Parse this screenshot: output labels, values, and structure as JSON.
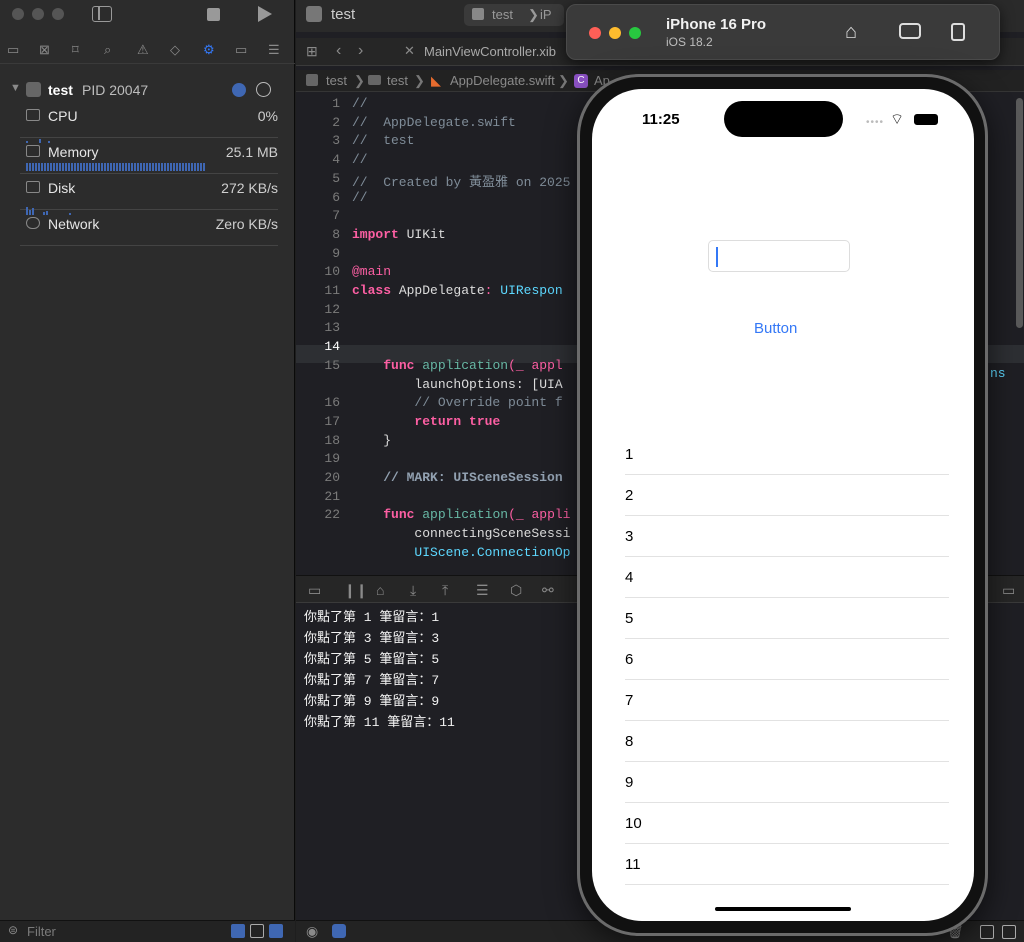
{
  "left_panel": {
    "process_name": "test",
    "process_pid": "PID 20047",
    "gauges": [
      {
        "label": "CPU",
        "value": "0%"
      },
      {
        "label": "Memory",
        "value": "25.1 MB"
      },
      {
        "label": "Disk",
        "value": "272 KB/s"
      },
      {
        "label": "Network",
        "value": "Zero KB/s"
      }
    ],
    "filter_placeholder": "Filter"
  },
  "editor": {
    "scheme_name": "test",
    "device_prefix": "iP",
    "tab_file": "MainViewController.xib",
    "jump_bar": [
      "test",
      "test",
      "AppDelegate.swift",
      "Ap"
    ],
    "code_lines": [
      {
        "n": "1",
        "t": "//"
      },
      {
        "n": "2",
        "t": "//  AppDelegate.swift"
      },
      {
        "n": "3",
        "t": "//  test"
      },
      {
        "n": "4",
        "t": "//"
      },
      {
        "n": "5",
        "t": "//  Created by 黃盈雅 on 2025"
      },
      {
        "n": "6",
        "t": "//"
      },
      {
        "n": "7",
        "t": ""
      },
      {
        "n": "8",
        "t": "import UIKit"
      },
      {
        "n": "9",
        "t": ""
      },
      {
        "n": "10",
        "t": "@main"
      },
      {
        "n": "11",
        "t": "class AppDelegate: UIRespon"
      },
      {
        "n": "12",
        "t": ""
      },
      {
        "n": "13",
        "t": ""
      },
      {
        "n": "14",
        "t": ""
      },
      {
        "n": "15",
        "t": "    func application(_ appl"
      },
      {
        "n": "",
        "t": "        launchOptions: [UIA"
      },
      {
        "n": "16",
        "t": "        // Override point f"
      },
      {
        "n": "17",
        "t": "        return true"
      },
      {
        "n": "18",
        "t": "    }"
      },
      {
        "n": "19",
        "t": ""
      },
      {
        "n": "20",
        "t": "    // MARK: UISceneSession"
      },
      {
        "n": "21",
        "t": ""
      },
      {
        "n": "22",
        "t": "    func application(_ appli"
      },
      {
        "n": "",
        "t": "        connectingSceneSessi"
      },
      {
        "n": "",
        "t": "        UIScene.ConnectionOp"
      }
    ],
    "right_overflow_text": "ns"
  },
  "console": {
    "lines": [
      "你點了第 1 筆留言：1",
      "你點了第 3 筆留言：3",
      "你點了第 5 筆留言：5",
      "你點了第 7 筆留言：7",
      "你點了第 9 筆留言：9",
      "你點了第 11 筆留言：11"
    ]
  },
  "simulator": {
    "device_name": "iPhone 16 Pro",
    "os_version": "iOS 18.2",
    "status_time": "11:25",
    "button_label": "Button",
    "list_rows": [
      "1",
      "2",
      "3",
      "4",
      "5",
      "6",
      "7",
      "8",
      "9",
      "10",
      "11"
    ]
  },
  "colors": {
    "accent": "#3478f6",
    "keyword": "#fc5fa3",
    "type": "#5dd8ff",
    "comment": "#7f8c98"
  }
}
